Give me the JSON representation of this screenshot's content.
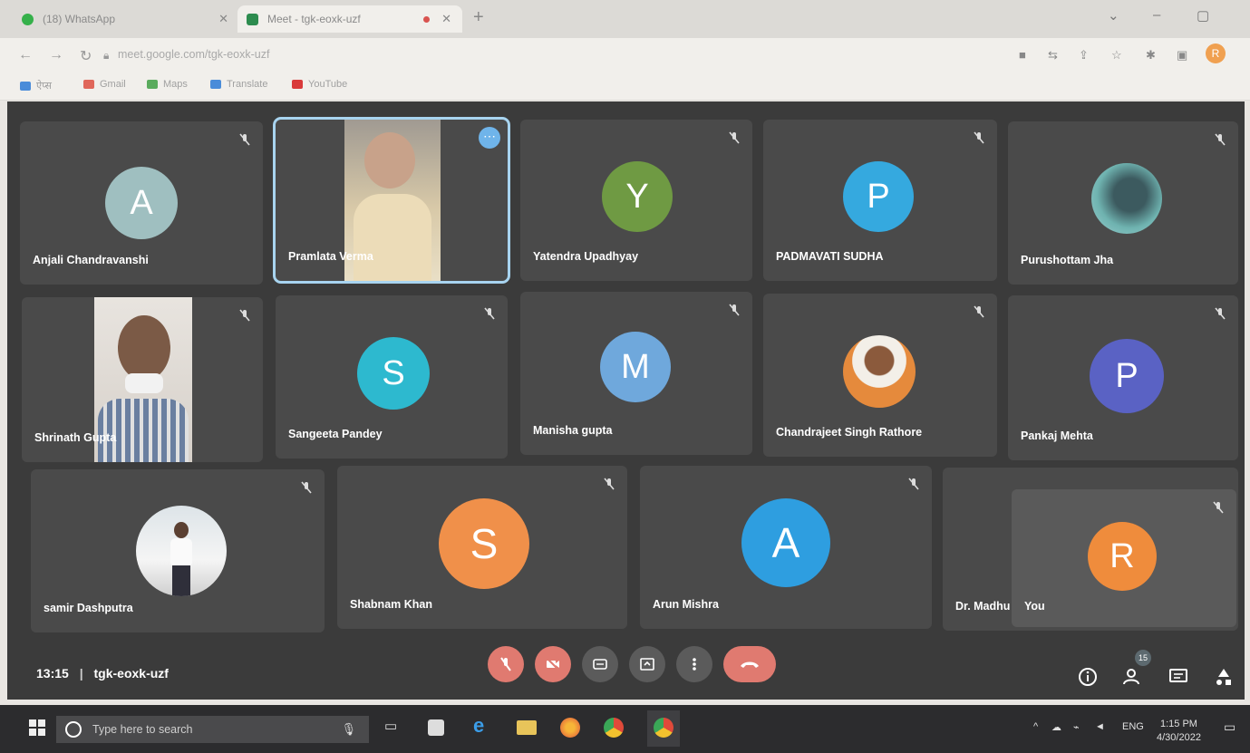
{
  "browser": {
    "tabs": [
      {
        "title": "(18) WhatsApp",
        "active": false,
        "icon_color": "#35b04a"
      },
      {
        "title": "Meet - tgk-eoxk-uzf",
        "active": true,
        "icon_color": "#2d8c4f",
        "recording": true
      }
    ],
    "url": "meet.google.com/tgk-eoxk-uzf",
    "profile_initial": "R",
    "bookmarks": [
      {
        "label": "ऐप्स",
        "icon": "apps-icon"
      },
      {
        "label": "Gmail",
        "icon": "gmail-icon"
      },
      {
        "label": "Maps",
        "icon": "maps-icon"
      },
      {
        "label": "Translate",
        "icon": "translate-icon"
      },
      {
        "label": "YouTube",
        "icon": "youtube-icon"
      }
    ]
  },
  "meeting": {
    "time": "13:15",
    "code": "tgk-eoxk-uzf",
    "participants": [
      {
        "name": "Anjali Chandravanshi",
        "type": "letter",
        "initial": "A",
        "color": "#9fbfc0"
      },
      {
        "name": "Pramlata Verma",
        "type": "video",
        "speaking": true
      },
      {
        "name": "Yatendra Upadhyay",
        "type": "letter",
        "initial": "Y",
        "color": "#6f9a43"
      },
      {
        "name": "PADMAVATI SUDHA",
        "type": "letter",
        "initial": "P",
        "color": "#35a9df"
      },
      {
        "name": "Purushottam Jha",
        "type": "photo"
      },
      {
        "name": "Shrinath Gupta",
        "type": "video"
      },
      {
        "name": "Sangeeta Pandey",
        "type": "letter",
        "initial": "S",
        "color": "#2db9cf"
      },
      {
        "name": "Manisha gupta",
        "type": "letter",
        "initial": "M",
        "color": "#6fa8dc"
      },
      {
        "name": "Chandrajeet Singh Rathore",
        "type": "photo"
      },
      {
        "name": "Pankaj Mehta",
        "type": "letter",
        "initial": "P",
        "color": "#5a62c4"
      },
      {
        "name": "samir Dashputra",
        "type": "photo"
      },
      {
        "name": "Shabnam Khan",
        "type": "letter",
        "initial": "S",
        "color": "#f0904a"
      },
      {
        "name": "Arun Mishra",
        "type": "letter",
        "initial": "A",
        "color": "#2e9ee0"
      },
      {
        "name": "Dr. Madhu",
        "type": "letter"
      },
      {
        "name": "You",
        "type": "letter",
        "initial": "R",
        "color": "#ef8c3c"
      }
    ],
    "people_count": "15"
  },
  "taskbar": {
    "search_placeholder": "Type here to search",
    "lang": "ENG",
    "clock_time": "1:15 PM",
    "clock_date": "4/30/2022"
  }
}
